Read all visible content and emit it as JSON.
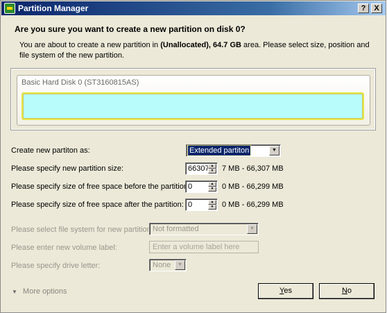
{
  "window": {
    "title": "Partition Manager",
    "help_button": "?",
    "close_button": "X"
  },
  "heading": "Are you sure you want to create a new partition on disk 0?",
  "description": {
    "prefix": "You are about to create a new partition in ",
    "area_name": "(Unallocated), 64.7 GB",
    "suffix": " area. Please select size, position and file system of the new partition."
  },
  "disk": {
    "label": "Basic Hard Disk 0 (ST3160815AS)"
  },
  "form": {
    "create_as": {
      "label": "Create new partiton as:",
      "value": "Extended partiton"
    },
    "size": {
      "label": "Please specify new partition size:",
      "value": "66307",
      "range": "7 MB - 66,307 MB"
    },
    "free_before": {
      "label": "Please specify size of free space before the partition:",
      "value": "0",
      "range": "0 MB - 66,299 MB"
    },
    "free_after": {
      "label": "Please specify size of free space after the partition:",
      "value": "0",
      "range": "0 MB - 66,299 MB"
    },
    "file_system": {
      "label": "Please select file system for new partition:",
      "value": "Not formatted"
    },
    "volume_label": {
      "label": "Please enter new volume label:",
      "placeholder": "Enter a volume label here"
    },
    "drive_letter": {
      "label": "Please specify drive letter:",
      "value": "None"
    }
  },
  "more_options": "More options",
  "buttons": {
    "yes": {
      "underlined": "Y",
      "rest": "es"
    },
    "no": {
      "underlined": "N",
      "rest": "o"
    }
  }
}
